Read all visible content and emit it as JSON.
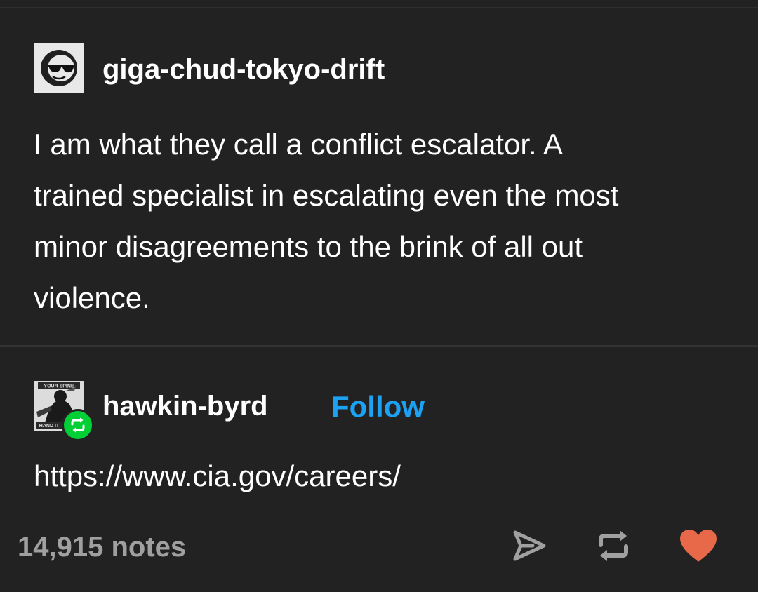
{
  "post1": {
    "username": "giga-chud-tokyo-drift",
    "avatar_icon": "sunglasses-face-icon",
    "body": "I am what they call a conflict escalator. A\ntrained specialist in escalating even the most\nminor disagreements to the brink of all out\nviolence."
  },
  "post2": {
    "username": "hawkin-byrd",
    "follow_label": "Follow",
    "avatar_icon": "manga-avatar-icon",
    "avatar_caption_top": "YOUR SPINE",
    "avatar_caption_bottom": "HAND IT",
    "badge_icon": "reblog-badge-icon",
    "body": "https://www.cia.gov/careers/"
  },
  "footer": {
    "notes": "14,915 notes",
    "icons": [
      "share-icon",
      "reblog-icon",
      "heart-icon"
    ]
  },
  "colors": {
    "background": "#222222",
    "text": "#ffffff",
    "follow": "#1da1f2",
    "muted": "#a0a0a0",
    "reblog_badge": "#00cf35",
    "heart": "#e8684a"
  }
}
